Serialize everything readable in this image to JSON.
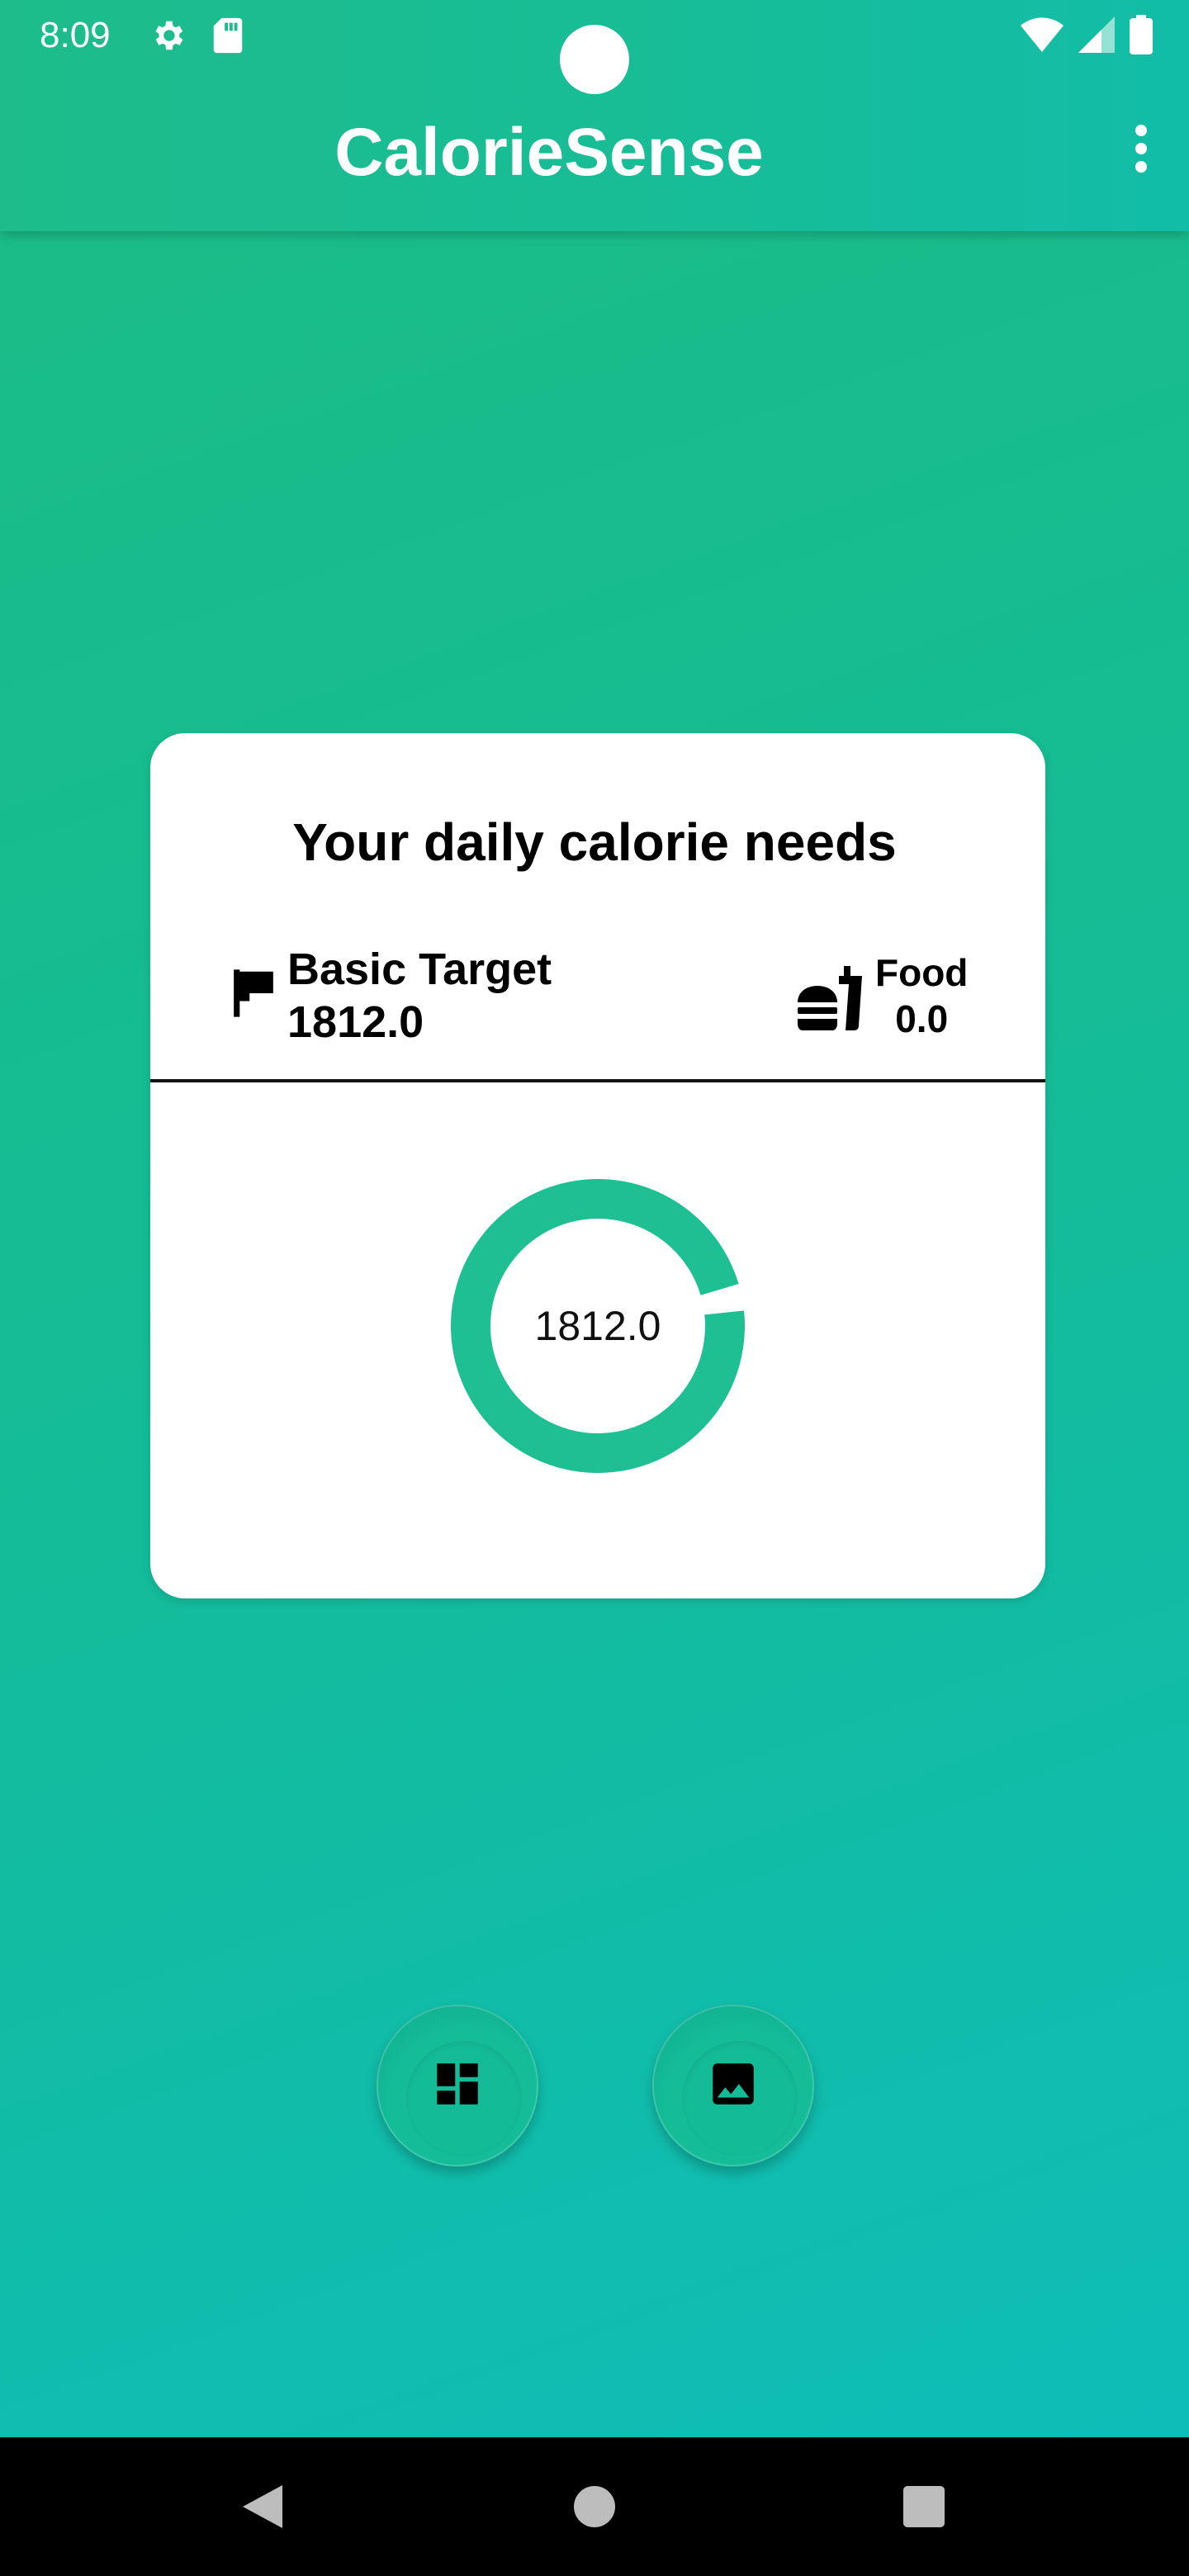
{
  "status_bar": {
    "time": "8:09",
    "left_icons": [
      "gear-icon",
      "sd-card-icon"
    ],
    "right_icons": [
      "wifi-icon",
      "cell-signal-icon",
      "battery-icon"
    ]
  },
  "app_bar": {
    "title": "CalorieSense",
    "menu_icon": "more-vert-icon"
  },
  "card": {
    "title": "Your daily calorie needs",
    "target": {
      "icon": "flag-icon",
      "label": "Basic Target",
      "value": "1812.0"
    },
    "food": {
      "icon": "fastfood-icon",
      "label": "Food",
      "value": "0.0"
    },
    "progress": {
      "center_text": "1812.0",
      "ring_color": "#1dbf93",
      "filled_fraction": 0.97
    }
  },
  "actions": [
    {
      "name": "dashboard",
      "icon": "dashboard-icon"
    },
    {
      "name": "gallery",
      "icon": "image-icon"
    }
  ],
  "colors": {
    "accent": "#1dbf93",
    "background_start": "#1bbd84",
    "background_end": "#0dbdbb"
  },
  "nav_bar": {
    "buttons": [
      "back-icon",
      "home-icon",
      "recents-icon"
    ]
  }
}
